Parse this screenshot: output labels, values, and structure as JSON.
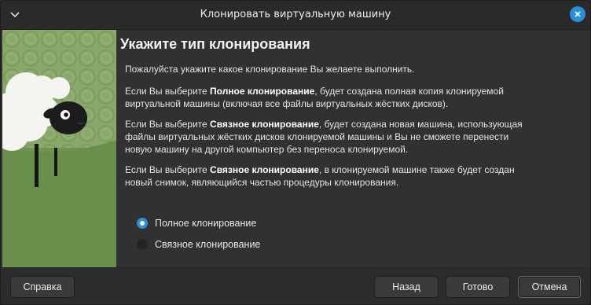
{
  "window": {
    "title": "Клонировать виртуальную машину",
    "menu_icon": "chevron-down-icon",
    "close_icon": "close-icon",
    "accent": "#2a8fd8"
  },
  "page": {
    "heading": "Укажите тип клонирования",
    "intro": "Пожалуйста укажите какое клонирование Вы желаете выполнить.",
    "p1": {
      "pre": "Если Вы выберите ",
      "bold": "Полное клонирование",
      "line1_post": ", будет создана полная копия клонируемой",
      "line2": "виртуальной машины (включая все файлы виртуальных жёстких дисков)."
    },
    "p2": {
      "pre": "Если Вы выберите ",
      "bold": "Связное клонирование",
      "line1_post": ", будет создана новая машина, использующая",
      "line2": "файлы виртуальных жёстких дисков клонируемой машины и Вы не сможете перенести",
      "line3": "новую машину на другой компьютер без переноса клонируемой."
    },
    "p3": {
      "pre": "Если Вы выберите ",
      "bold": "Связное клонирование",
      "line1_post": ", в клонируемой машине также будет создан",
      "line2": "новый снимок, являющийся частью процедуры клонирования."
    }
  },
  "options": [
    {
      "label": "Полное клонирование",
      "checked": true
    },
    {
      "label": "Связное клонирование",
      "checked": false
    }
  ],
  "buttons": {
    "help": "Справка",
    "back": "Назад",
    "finish": "Готово",
    "cancel": "Отмена"
  }
}
